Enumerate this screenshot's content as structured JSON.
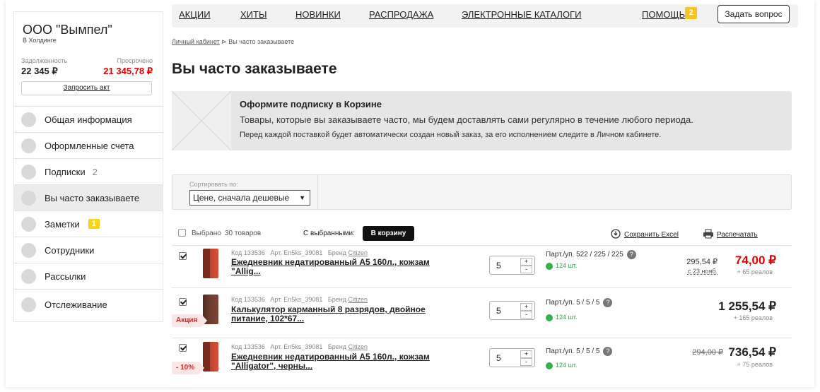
{
  "company": {
    "name": "ООО \"Вымпел\"",
    "sub": "В Холдинге"
  },
  "finance": {
    "debt_label": "Задолженность",
    "debt_value": "22 345 ₽",
    "overdue_label": "Просрочено",
    "overdue_value": "21 345,78 ₽",
    "request_act": "Запросить акт"
  },
  "menu": [
    {
      "label": "Общая информация"
    },
    {
      "label": "Оформленные счета"
    },
    {
      "label": "Подписки",
      "count": "2"
    },
    {
      "label": "Вы часто заказываете",
      "active": true
    },
    {
      "label": "Заметки",
      "badge": "1"
    },
    {
      "label": "Сотрудники"
    },
    {
      "label": "Рассылки"
    },
    {
      "label": "Отслеживание"
    }
  ],
  "nav": {
    "items": [
      "АКЦИИ",
      "ХИТЫ",
      "НОВИНКИ",
      "РАСПРОДАЖА",
      "ЭЛЕКТРОННЫЕ КАТАЛОГИ"
    ],
    "help": "ПОМОЩЬ",
    "help_badge": "2",
    "ask": "Задать вопрос"
  },
  "breadcrumb": {
    "link": "Личный кабинет",
    "sep": " ⊳ ",
    "current": "Вы часто заказываете"
  },
  "page_title": "Вы часто заказываете",
  "promo": {
    "title": "Оформите подписку в Корзине",
    "text": "Товары, которые вы заказываете часто, мы будем доставлять сами регулярно в течение любого периода.",
    "note": "Перед каждой поставкой будет автоматически создан новый заказ, за его исполнением следите в Личном кабинете."
  },
  "sort": {
    "label": "Сортировать по:",
    "value": "Цене, сначала дешевые"
  },
  "toolbar": {
    "selected_label": "Выбрано",
    "selected_count": "30 товаров",
    "with_selected": "С выбранными:",
    "to_cart": "В корзину",
    "excel": "Сохранить Excel",
    "print": "Распечатать"
  },
  "products": [
    {
      "code": "Код 133536",
      "art": "Арт. En5ks_39081",
      "brand_label": "Бренд",
      "brand": "Citizen",
      "title": "Ежедневник недатированный А5 160л., кожзам \"Allig...",
      "qty": "5",
      "part": "Парт./уп.  522 / 225 / 225",
      "stock": "124 шт.",
      "old_price": "295,54 ₽",
      "old_price_note": "с 23 нояб.",
      "price": "74,00 ₽",
      "price_color": "#e30000",
      "bonus": "+ 65 реалов",
      "tag": "",
      "checked": true
    },
    {
      "code": "Код 133536",
      "art": "Арт. En5ks_39081",
      "brand_label": "Бренд",
      "brand": "Citizen",
      "title": "Калькулятор карманный 8 разрядов, двойное питание, 102*67...",
      "qty": "5",
      "part": "Парт./уп.  5 / 5 / 5",
      "stock": "124 шт.",
      "price": "1 255,54 ₽",
      "price_color": "#222222",
      "bonus": "+ 165 реалов",
      "tag": "Акция",
      "checked": true
    },
    {
      "code": "Код 133536",
      "art": "Арт. En5ks_39081",
      "brand_label": "Бренд",
      "brand": "Citizen",
      "title": "Ежедневник недатированный А5 160л., кожзам \"Alligator\", черны...",
      "qty": "5",
      "part": "Парт./уп.  5 / 5 / 5",
      "stock": "124 шт.",
      "crossed_price": "294,00 ₽",
      "price": "736,54 ₽",
      "price_color": "#222222",
      "bonus": "+ 75 реалов",
      "tag": "- 10%",
      "checked": true
    }
  ],
  "colors": {
    "accent_red": "#e30000",
    "badge_yellow": "#f7d51d",
    "stock_green": "#34b24f"
  }
}
